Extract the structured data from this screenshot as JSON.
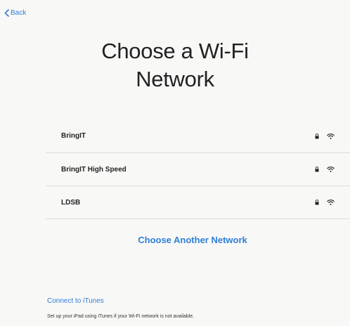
{
  "nav": {
    "back_label": "Back"
  },
  "title": {
    "line1": "Choose a Wi-Fi",
    "line2": "Network"
  },
  "networks": [
    {
      "name": "BringIT",
      "secured": true
    },
    {
      "name": "BringIT High Speed",
      "secured": true
    },
    {
      "name": "LDSB",
      "secured": true
    }
  ],
  "choose_another": "Choose Another Network",
  "itunes": {
    "link": "Connect to iTunes",
    "description": "Set up your iPad using iTunes if your Wi-Fi network is not available."
  },
  "colors": {
    "accent": "#2f7fd6",
    "background": "#f8f8f7",
    "divider": "#dcdcdc"
  },
  "icons": [
    "chevron-left-icon",
    "lock-icon",
    "wifi-icon"
  ]
}
